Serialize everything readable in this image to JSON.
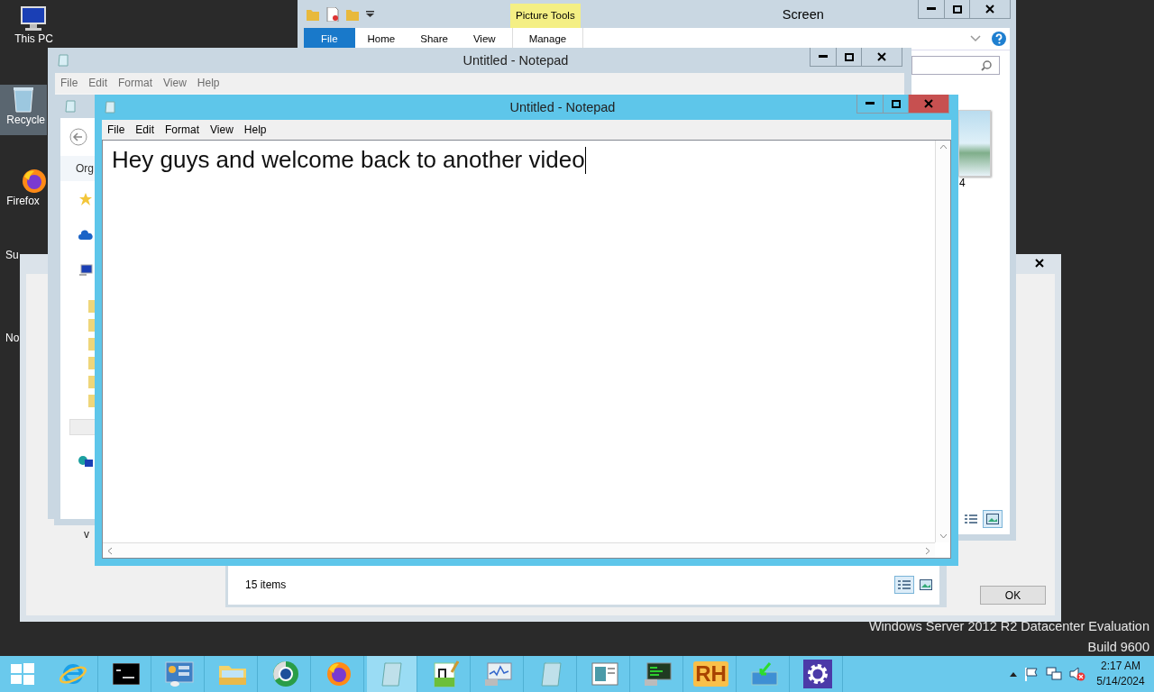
{
  "desktop_icons": [
    {
      "kind": "pc",
      "label": "This PC"
    },
    {
      "kind": "bin",
      "label": "Recycle"
    },
    {
      "kind": "firefox",
      "label": "Firefox"
    },
    {
      "kind": "none",
      "label": "Su"
    },
    {
      "kind": "none",
      "label": "No"
    }
  ],
  "dialog": {
    "fragment": "v",
    "ok_button": "OK"
  },
  "explorer_back": {
    "status": "15 items"
  },
  "explorer": {
    "title": "Screen",
    "context_tab": "Picture Tools",
    "tabs": [
      {
        "label": "File",
        "kind": "file"
      },
      {
        "label": "Home",
        "kind": "tab"
      },
      {
        "label": "Share",
        "kind": "tab"
      },
      {
        "label": "View",
        "kind": "tab"
      },
      {
        "label": "Manage",
        "kind": "context"
      }
    ],
    "thumbnail_caption": "4"
  },
  "explorer_left": {
    "toolbar_fragment": "Org"
  },
  "notepads": [
    {
      "title": "Untitled - Notepad",
      "active": false,
      "menu": [
        "File",
        "Edit",
        "Format",
        "View",
        "Help"
      ]
    },
    {
      "title": "Untitled - Notepad",
      "active": true,
      "menu": [
        "File",
        "Edit",
        "Format",
        "View",
        "Help"
      ],
      "text": "Hey guys and welcome back to another video"
    }
  ],
  "os_watermark": [
    "Windows Server 2012 R2 Datacenter Evaluation",
    "Build 9600"
  ],
  "taskbar": {
    "apps": [
      {
        "kind": "start",
        "selected": false
      },
      {
        "kind": "ie",
        "selected": false
      },
      {
        "kind": "cmd",
        "selected": false
      },
      {
        "kind": "server",
        "selected": false
      },
      {
        "kind": "folder",
        "selected": false
      },
      {
        "kind": "globe",
        "selected": false
      },
      {
        "kind": "firefox",
        "selected": false
      },
      {
        "kind": "notepad",
        "selected": true
      },
      {
        "kind": "npp",
        "selected": false
      },
      {
        "kind": "perf",
        "selected": false
      },
      {
        "kind": "notepad",
        "selected": false
      },
      {
        "kind": "window",
        "selected": false
      },
      {
        "kind": "monitor",
        "selected": false
      },
      {
        "kind": "rh",
        "selected": false,
        "label": "RH"
      },
      {
        "kind": "install",
        "selected": false
      },
      {
        "kind": "gear",
        "selected": false
      }
    ],
    "clock": {
      "time": "2:17 AM",
      "date": "5/14/2024"
    }
  }
}
